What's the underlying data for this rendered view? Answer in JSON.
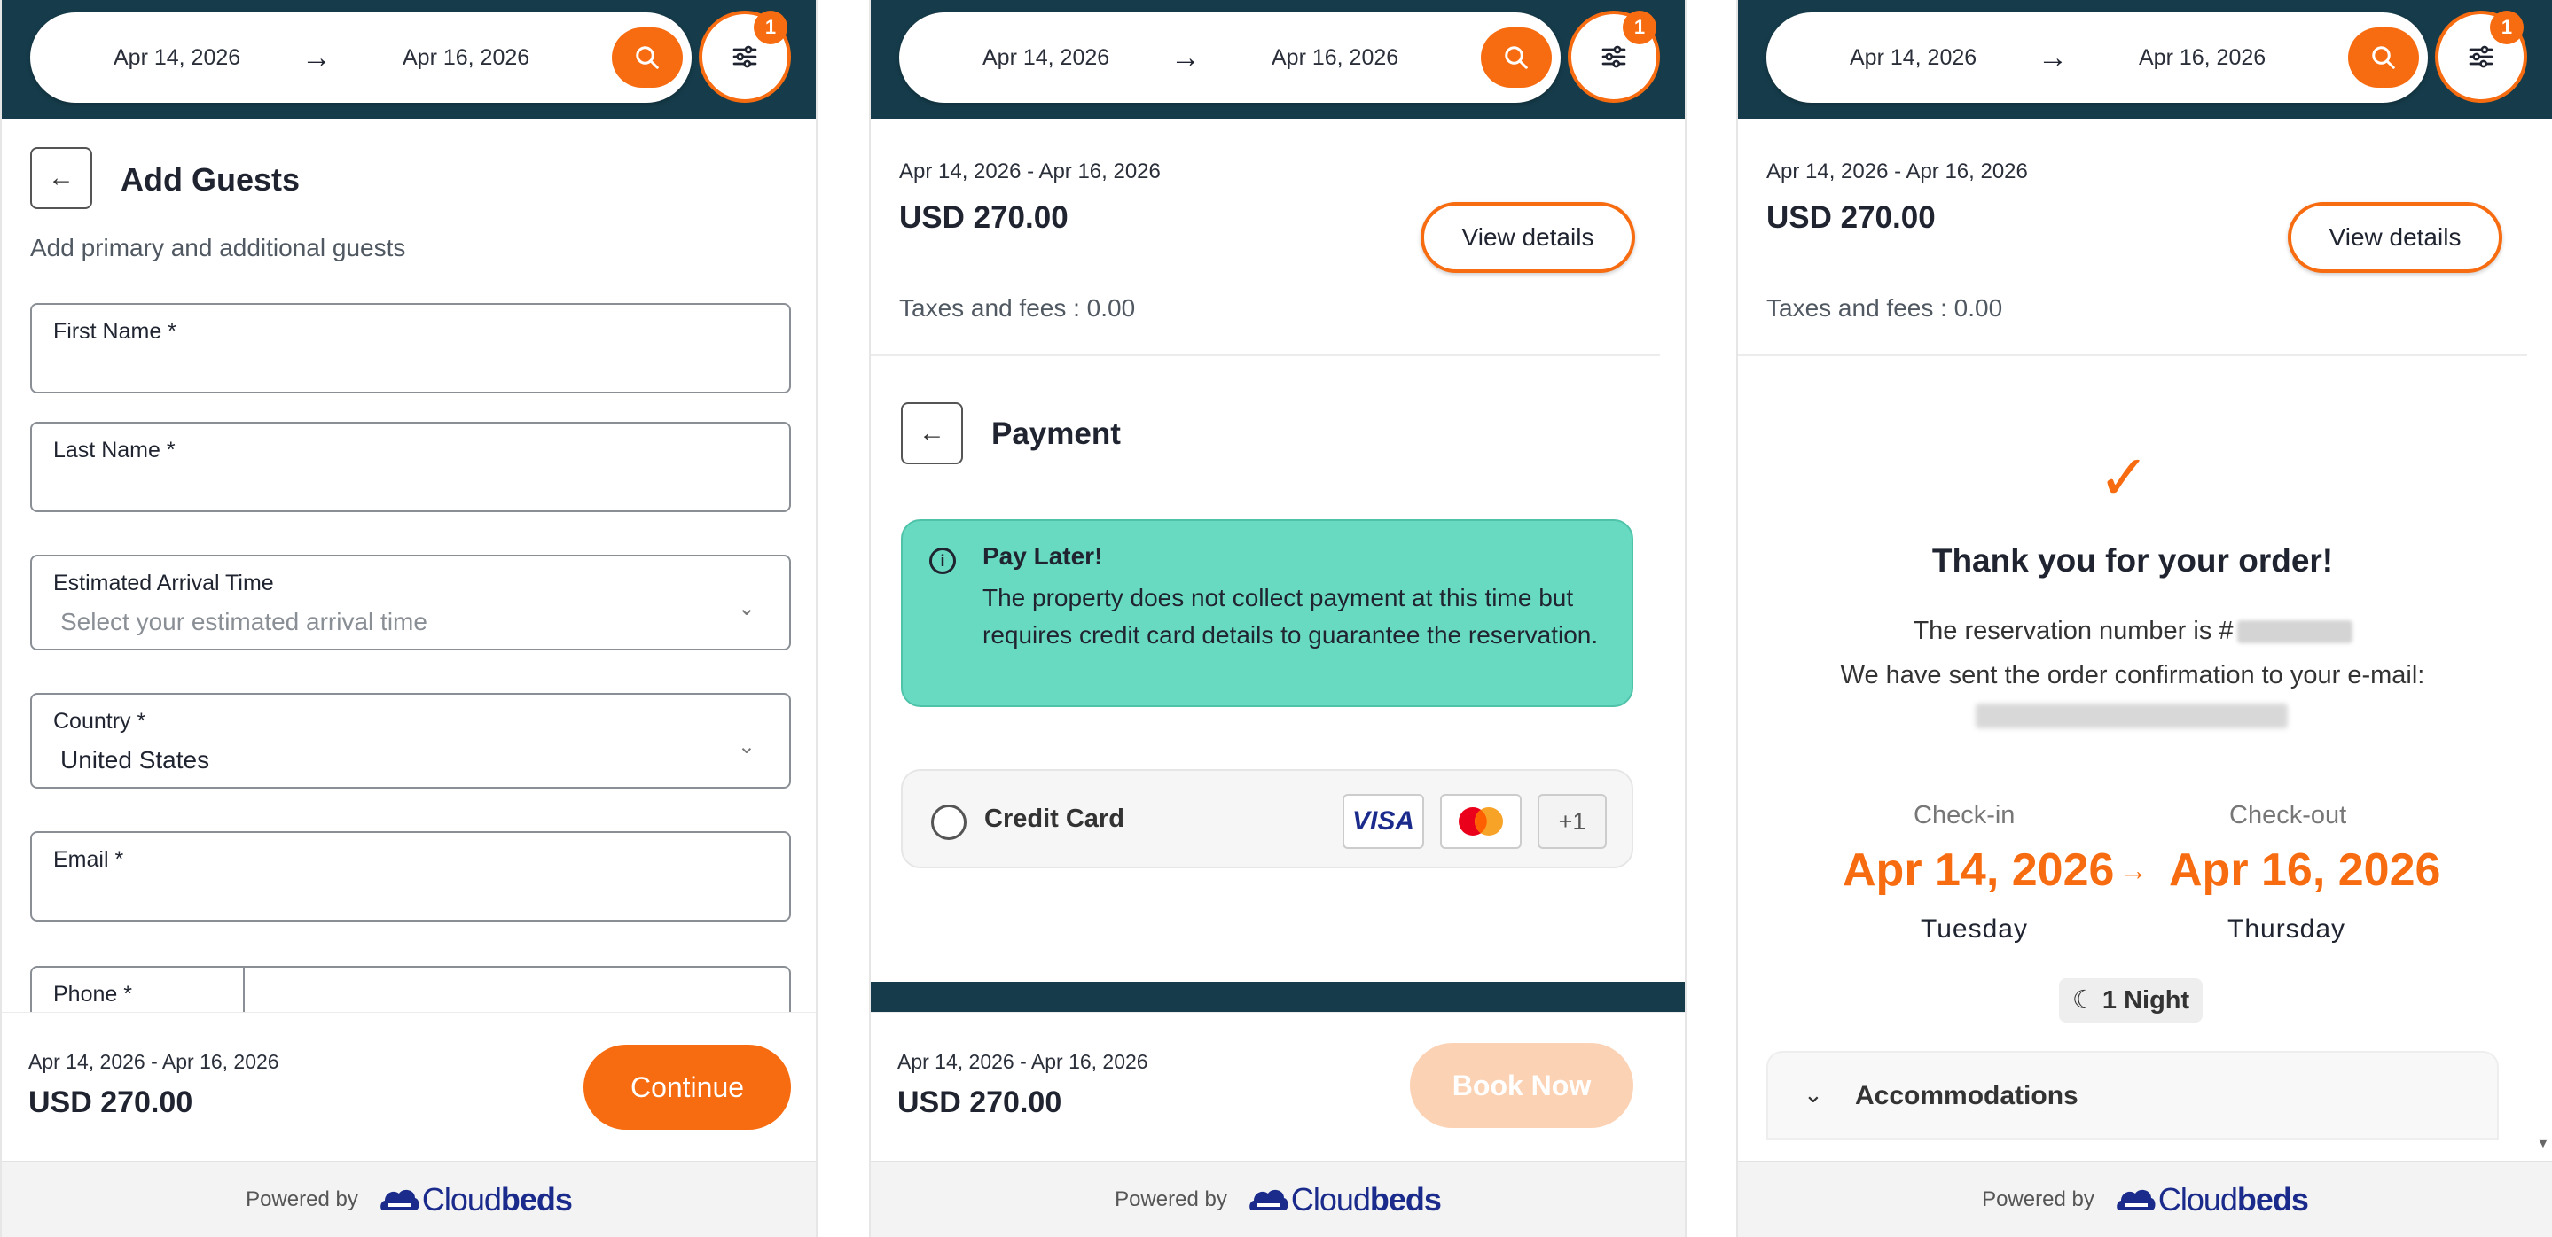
{
  "header": {
    "checkin": "Apr 14, 2026",
    "arrow": "→",
    "checkout": "Apr 16, 2026",
    "filter_badge": "1"
  },
  "summary": {
    "date_range": "Apr 14, 2026 - Apr 16, 2026",
    "price": "USD 270.00",
    "view_details": "View details",
    "taxes": "Taxes and fees : 0.00"
  },
  "footer": {
    "date_range": "Apr 14, 2026 - Apr 16, 2026",
    "price": "USD 270.00",
    "continue_label": "Continue",
    "book_now_label": "Book Now",
    "powered_by": "Powered by",
    "brand_light": "Cloud",
    "brand_bold": "beds"
  },
  "guests": {
    "title": "Add Guests",
    "subtitle": "Add primary and additional guests",
    "first_name_label": "First Name *",
    "last_name_label": "Last Name *",
    "arrival_label": "Estimated Arrival Time",
    "arrival_placeholder": "Select your estimated arrival time",
    "country_label": "Country *",
    "country_value": "United States",
    "email_label": "Email *",
    "phone_label": "Phone *"
  },
  "payment": {
    "title": "Payment",
    "pay_later_title": "Pay Later!",
    "pay_later_text": "The property does not collect payment at this time but requires credit card details to guarantee the reservation.",
    "credit_card_label": "Credit Card",
    "card_visa": "VISA",
    "card_more": "+1"
  },
  "confirmation": {
    "thanks": "Thank you for your order!",
    "reservation_text": "The reservation number is #",
    "sent_text": "We have sent the order confirmation to your e-mail:",
    "checkin_label": "Check-in",
    "checkout_label": "Check-out",
    "checkin_date": "Apr 14, 2026",
    "checkout_date": "Apr 16, 2026",
    "checkin_day": "Tuesday",
    "checkout_day": "Thursday",
    "nights": "1 Night",
    "accommodations": "Accommodations"
  },
  "colors": {
    "accent": "#f76c10",
    "header_bg": "#163c4b",
    "pay_later_bg": "#69dac2",
    "brand_blue": "#1a2b8c"
  }
}
